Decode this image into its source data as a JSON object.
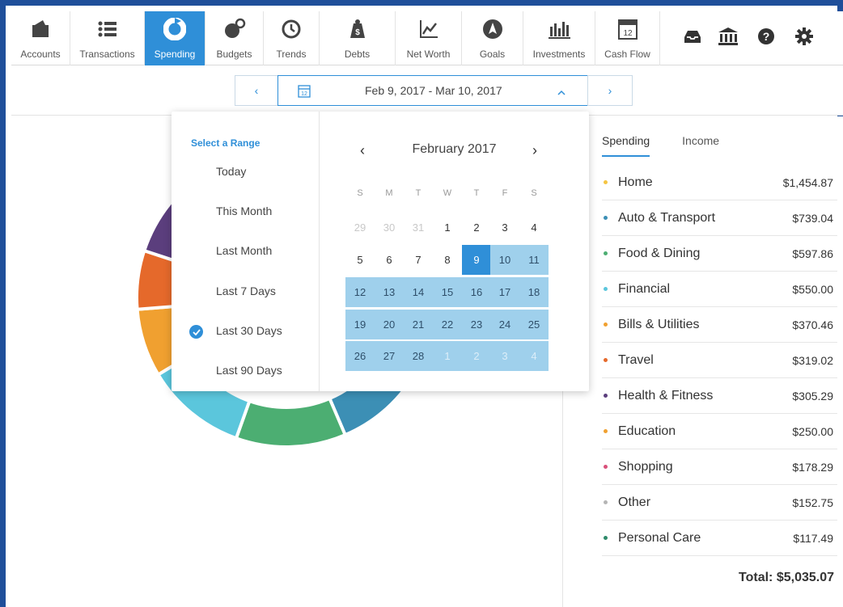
{
  "nav": {
    "items": [
      {
        "label": "Accounts",
        "icon": "accounts-icon",
        "active": false
      },
      {
        "label": "Transactions",
        "icon": "list-icon",
        "active": false
      },
      {
        "label": "Spending",
        "icon": "pie-chart-icon",
        "active": true
      },
      {
        "label": "Budgets",
        "icon": "budget-icon",
        "active": false
      },
      {
        "label": "Trends",
        "icon": "clock-icon",
        "active": false
      },
      {
        "label": "Debts",
        "icon": "weight-icon",
        "active": false
      },
      {
        "label": "Net Worth",
        "icon": "line-chart-icon",
        "active": false
      },
      {
        "label": "Goals",
        "icon": "compass-icon",
        "active": false
      },
      {
        "label": "Investments",
        "icon": "bar-chart-icon",
        "active": false
      },
      {
        "label": "Cash Flow",
        "icon": "calendar-icon",
        "active": false
      },
      {
        "label": "12",
        "icon": "calendar-day",
        "active": false
      }
    ],
    "utility_icons": [
      "inbox-icon",
      "bank-icon",
      "help-icon",
      "gear-icon"
    ]
  },
  "date_range": {
    "label": "Feb 9, 2017 - Mar 10, 2017",
    "prev": "‹",
    "next": "›",
    "cal_day": "12"
  },
  "picker": {
    "title": "Select a Range",
    "ranges": [
      "Today",
      "This Month",
      "Last Month",
      "Last 7 Days",
      "Last 30 Days",
      "Last 90 Days"
    ],
    "selected_range": "Last 30 Days",
    "month_label": "February 2017",
    "prev": "‹",
    "next": "›",
    "weekdays": [
      "S",
      "M",
      "T",
      "W",
      "T",
      "F",
      "S"
    ],
    "weeks": [
      [
        "29",
        "30",
        "31",
        "1",
        "2",
        "3",
        "4"
      ],
      [
        "5",
        "6",
        "7",
        "8",
        "9",
        "10",
        "11"
      ],
      [
        "12",
        "13",
        "14",
        "15",
        "16",
        "17",
        "18"
      ],
      [
        "19",
        "20",
        "21",
        "22",
        "23",
        "24",
        "25"
      ],
      [
        "26",
        "27",
        "28",
        "1",
        "2",
        "3",
        "4"
      ]
    ],
    "selected_day": "9"
  },
  "panel": {
    "tabs": [
      "Spending",
      "Income"
    ],
    "active_tab": "Spending",
    "categories": [
      {
        "name": "Home",
        "amount": "$1,454.87",
        "color": "#f5c542"
      },
      {
        "name": "Auto & Transport",
        "amount": "$739.04",
        "color": "#3c8fb5"
      },
      {
        "name": "Food & Dining",
        "amount": "$597.86",
        "color": "#4cae72"
      },
      {
        "name": "Financial",
        "amount": "$550.00",
        "color": "#5bc6dc"
      },
      {
        "name": "Bills & Utilities",
        "amount": "$370.46",
        "color": "#f0a030"
      },
      {
        "name": "Travel",
        "amount": "$319.02",
        "color": "#e5692b"
      },
      {
        "name": "Health & Fitness",
        "amount": "$305.29",
        "color": "#5b3e7d"
      },
      {
        "name": "Education",
        "amount": "$250.00",
        "color": "#f0a030"
      },
      {
        "name": "Shopping",
        "amount": "$178.29",
        "color": "#d9507a"
      },
      {
        "name": "Other",
        "amount": "$152.75",
        "color": "#b5b5b5"
      },
      {
        "name": "Personal Care",
        "amount": "$117.49",
        "color": "#2e8a6a"
      }
    ],
    "total": "Total: $5,035.07"
  }
}
